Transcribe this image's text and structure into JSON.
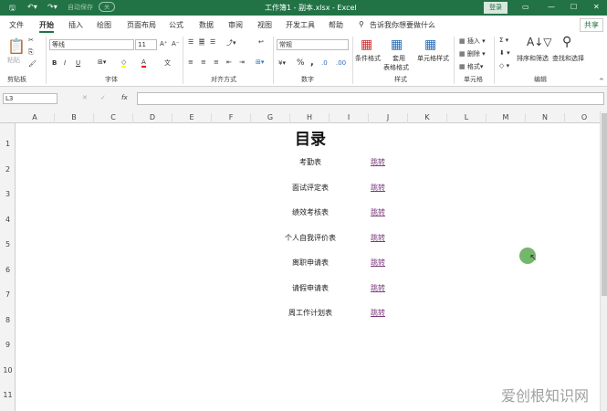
{
  "titlebar": {
    "autosave": "自动保存",
    "autosave_state": "关",
    "title": "工作簿1 - 副本.xlsx  -  Excel",
    "login": "登录"
  },
  "tabs": [
    "文件",
    "开始",
    "插入",
    "绘图",
    "页面布局",
    "公式",
    "数据",
    "审阅",
    "视图",
    "开发工具",
    "帮助"
  ],
  "tell_me": "告诉我你想要做什么",
  "share": "共享",
  "ribbon": {
    "paste": "粘贴",
    "font_name": "等线",
    "font_size": "11",
    "number_format": "常规",
    "conditional_format": "条件格式",
    "table_format_1": "套用",
    "table_format_2": "表格格式",
    "cell_styles": "单元格样式",
    "insert": "插入",
    "delete": "删除",
    "format": "格式",
    "sort_filter": "排序和筛选",
    "find_select": "查找和选择",
    "groups": [
      "剪贴板",
      "字体",
      "对齐方式",
      "数字",
      "样式",
      "单元格",
      "编辑"
    ]
  },
  "formula_bar": {
    "name_box": "L3",
    "value": ""
  },
  "columns": [
    "A",
    "B",
    "C",
    "D",
    "E",
    "F",
    "G",
    "H",
    "I",
    "J",
    "K",
    "L",
    "M",
    "N",
    "O"
  ],
  "rows": [
    "1",
    "2",
    "3",
    "4",
    "5",
    "6",
    "7",
    "8",
    "9",
    "10",
    "11"
  ],
  "sheet": {
    "title": "目录",
    "entries": [
      {
        "name": "考勤表",
        "link": "跳转"
      },
      {
        "name": "面试评定表",
        "link": "跳转"
      },
      {
        "name": "绩效考核表",
        "link": "跳转"
      },
      {
        "name": "个人自我评价表",
        "link": "跳转"
      },
      {
        "name": "离职申请表",
        "link": "跳转"
      },
      {
        "name": "请假申请表",
        "link": "跳转"
      },
      {
        "name": "周工作计划表",
        "link": "跳转"
      }
    ]
  },
  "watermark": "爱创根知识网",
  "colors": {
    "accent": "#217346",
    "link": "#7a3a7a",
    "cursor": "#5aaa50"
  }
}
